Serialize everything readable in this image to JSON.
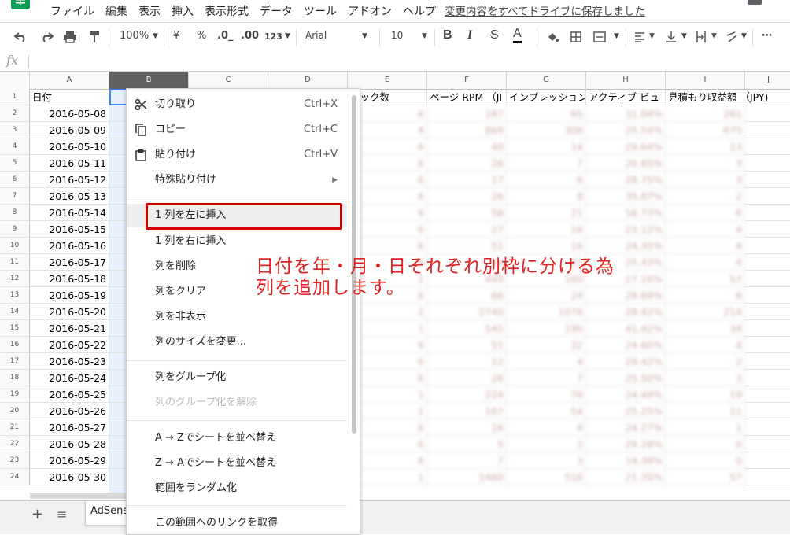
{
  "menubar": {
    "items": [
      "ファイル",
      "編集",
      "表示",
      "挿入",
      "表示形式",
      "データ",
      "ツール",
      "アドオン",
      "ヘルプ"
    ],
    "save_status": "変更内容をすべてドライブに保存しました"
  },
  "toolbar": {
    "zoom": "100%",
    "currency": "¥",
    "percent": "%",
    "decimal_decrease": ".0_",
    "decimal_increase": ".00",
    "format_more": "123",
    "font": "Arial",
    "font_size": "10",
    "bold": "B",
    "italic": "I",
    "strike": "S",
    "text_color": "A"
  },
  "formula_bar": {
    "fx": "fx",
    "value": ""
  },
  "columns": [
    "A",
    "B",
    "C",
    "D",
    "E",
    "F",
    "G",
    "H",
    "I",
    "J"
  ],
  "header_row": {
    "A": "日付",
    "E": "リック数",
    "F": "ページ RPM （JI",
    "G": "インプレッション",
    "H": "アクティブ ビュ",
    "I": "見積もり収益額 （JPY)"
  },
  "rows": [
    {
      "n": "2",
      "date": "2016-05-08",
      "e": "6",
      "f": "167",
      "g": "65",
      "h": "31.04%",
      "i": "261"
    },
    {
      "n": "3",
      "date": "2016-05-09",
      "e": "4",
      "f": "869",
      "g": "306",
      "h": "25.54%",
      "i": "675"
    },
    {
      "n": "4",
      "date": "2016-05-10",
      "e": "6",
      "f": "40",
      "g": "14",
      "h": "29.64%",
      "i": "13"
    },
    {
      "n": "5",
      "date": "2016-05-11",
      "e": "6",
      "f": "26",
      "g": "7",
      "h": "20.65%",
      "i": "3"
    },
    {
      "n": "6",
      "date": "2016-05-12",
      "e": "6",
      "f": "17",
      "g": "6",
      "h": "28.75%",
      "i": "3"
    },
    {
      "n": "7",
      "date": "2016-05-13",
      "e": "6",
      "f": "26",
      "g": "8",
      "h": "35.87%",
      "i": "2"
    },
    {
      "n": "8",
      "date": "2016-05-14",
      "e": "6",
      "f": "58",
      "g": "21",
      "h": "16.73%",
      "i": "6"
    },
    {
      "n": "9",
      "date": "2016-05-15",
      "e": "6",
      "f": "27",
      "g": "16",
      "h": "23.12%",
      "i": "4"
    },
    {
      "n": "10",
      "date": "2016-05-16",
      "e": "6",
      "f": "51",
      "g": "16",
      "h": "24.35%",
      "i": "4"
    },
    {
      "n": "11",
      "date": "2016-05-17",
      "e": "6",
      "f": "64",
      "g": "31",
      "h": "25.43%",
      "i": "4"
    },
    {
      "n": "12",
      "date": "2016-05-18",
      "e": "1",
      "f": "449",
      "g": "160",
      "h": "27.16%",
      "i": "57"
    },
    {
      "n": "13",
      "date": "2016-05-19",
      "e": "6",
      "f": "66",
      "g": "24",
      "h": "29.69%",
      "i": "6"
    },
    {
      "n": "14",
      "date": "2016-05-20",
      "e": "2",
      "f": "2740",
      "g": "1076",
      "h": "28.42%",
      "i": "214"
    },
    {
      "n": "15",
      "date": "2016-05-21",
      "e": "1",
      "f": "545",
      "g": "190",
      "h": "41.42%",
      "i": "34"
    },
    {
      "n": "16",
      "date": "2016-05-22",
      "e": "6",
      "f": "51",
      "g": "22",
      "h": "24.60%",
      "i": "4"
    },
    {
      "n": "17",
      "date": "2016-05-23",
      "e": "6",
      "f": "12",
      "g": "4",
      "h": "28.42%",
      "i": "2"
    },
    {
      "n": "18",
      "date": "2016-05-24",
      "e": "6",
      "f": "26",
      "g": "7",
      "h": "25.50%",
      "i": "3"
    },
    {
      "n": "19",
      "date": "2016-05-25",
      "e": "1",
      "f": "224",
      "g": "76",
      "h": "24.49%",
      "i": "19"
    },
    {
      "n": "20",
      "date": "2016-05-26",
      "e": "1",
      "f": "167",
      "g": "54",
      "h": "25.25%",
      "i": "11"
    },
    {
      "n": "21",
      "date": "2016-05-27",
      "e": "6",
      "f": "16",
      "g": "6",
      "h": "24.27%",
      "i": "1"
    },
    {
      "n": "22",
      "date": "2016-05-28",
      "e": "6",
      "f": "5",
      "g": "2",
      "h": "29.28%",
      "i": "0"
    },
    {
      "n": "23",
      "date": "2016-05-29",
      "e": "6",
      "f": "7",
      "g": "3",
      "h": "19.39%",
      "i": "0"
    },
    {
      "n": "24",
      "date": "2016-05-30",
      "e": "1",
      "f": "1460",
      "g": "516",
      "h": "21.35%",
      "i": "57"
    }
  ],
  "context_menu": {
    "cut": {
      "label": "切り取り",
      "shortcut": "Ctrl+X"
    },
    "copy": {
      "label": "コピー",
      "shortcut": "Ctrl+C"
    },
    "paste": {
      "label": "貼り付け",
      "shortcut": "Ctrl+V"
    },
    "paste_special": {
      "label": "特殊貼り付け"
    },
    "insert_left": {
      "label": "1 列を左に挿入"
    },
    "insert_right": {
      "label": "1 列を右に挿入"
    },
    "delete_col": {
      "label": "列を削除"
    },
    "clear_col": {
      "label": "列をクリア"
    },
    "hide_col": {
      "label": "列を非表示"
    },
    "resize_col": {
      "label": "列のサイズを変更..."
    },
    "group_col": {
      "label": "列をグループ化"
    },
    "ungroup_col": {
      "label": "列のグループ化を解除"
    },
    "sort_az": {
      "label": "A → Zでシートを並べ替え"
    },
    "sort_za": {
      "label": "Z → Aでシートを並べ替え"
    },
    "randomize": {
      "label": "範囲をランダム化"
    },
    "get_link": {
      "label": "この範囲へのリンクを取得"
    }
  },
  "annotation": {
    "line1": "日付を年・月・日それぞれ別枠に分ける為",
    "line2": "列を追加します。"
  },
  "sheets": {
    "active": "AdSens"
  },
  "colors": {
    "selected_col": "#616161",
    "col_b_fill": "#e8f0fe",
    "highlight_box": "#d00000",
    "annotation": "#e02020"
  }
}
